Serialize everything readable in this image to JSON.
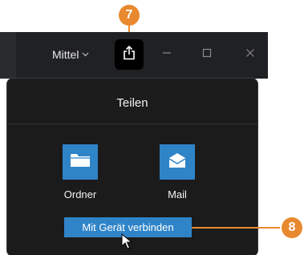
{
  "callouts": {
    "share": "7",
    "connect": "8"
  },
  "titlebar": {
    "zoom_label": "Mittel",
    "zoom_chevron": "⌵",
    "icons": {
      "share": "share-icon",
      "minimize": "minimize-icon",
      "maximize": "maximize-icon",
      "close": "close-icon"
    }
  },
  "share_panel": {
    "title": "Teilen",
    "targets": [
      {
        "label": "Ordner",
        "icon": "folder-icon"
      },
      {
        "label": "Mail",
        "icon": "mail-icon"
      }
    ],
    "connect_label": "Mit Gerät verbinden"
  },
  "colors": {
    "accent_blue": "#2f84c8",
    "callout_orange": "#e8892f",
    "panel_bg": "#1b1b1b",
    "titlebar_bg": "#202124"
  }
}
